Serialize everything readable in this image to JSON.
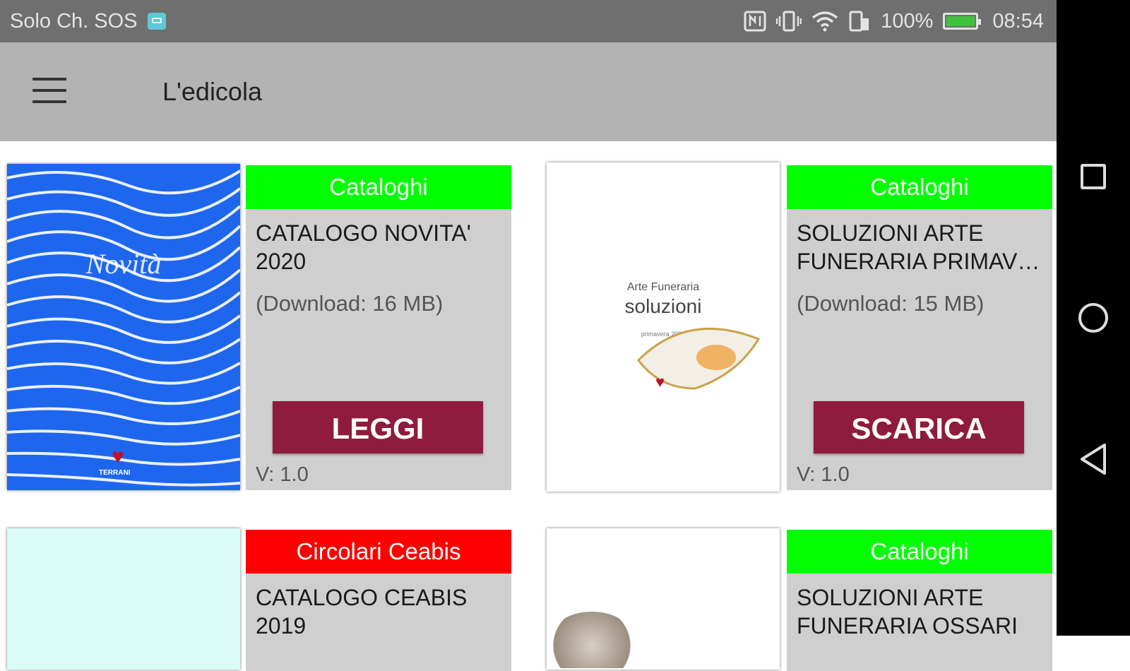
{
  "status_bar": {
    "carrier": "Solo Ch. SOS",
    "icons": [
      "nfc-icon",
      "vibrate-icon",
      "wifi-icon",
      "data-icon",
      "battery-icon"
    ],
    "battery": "100%",
    "time": "08:54"
  },
  "app_bar": {
    "title": "L'edicola"
  },
  "cards": [
    {
      "category": "Cataloghi",
      "category_color": "#00ff00",
      "title_lines": [
        "CATALOGO NOVITA'",
        "2020"
      ],
      "size": "(Download: 16 MB)",
      "action": "LEGGI",
      "version": "V: 1.0",
      "cover": {
        "title": "Novità",
        "logo": "TERRANI"
      }
    },
    {
      "category": "Cataloghi",
      "category_color": "#00ff00",
      "title_lines": [
        "SOLUZIONI ARTE",
        "FUNERARIA PRIMAVE..."
      ],
      "size": "(Download: 15 MB)",
      "action": "SCARICA",
      "version": "V: 1.0",
      "cover": {
        "line1": "Arte Funeraria",
        "line2": "soluzioni",
        "line3": "primavera 2020"
      }
    },
    {
      "category": "Circolari Ceabis",
      "category_color": "#ff0000",
      "title_lines": [
        "CATALOGO CEABIS",
        "2019"
      ]
    },
    {
      "category": "Cataloghi",
      "category_color": "#00ff00",
      "title_lines": [
        "SOLUZIONI ARTE",
        "FUNERARIA OSSARI"
      ]
    }
  ],
  "colors": {
    "action_button": "#8f1b3e",
    "app_bar": "#b3b3b3",
    "status_bar": "#6f6f6f"
  }
}
